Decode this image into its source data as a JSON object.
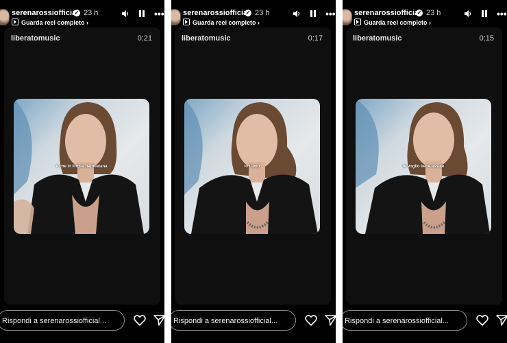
{
  "stories": [
    {
      "header": {
        "username": "serenarossiofficial",
        "time": "23 h",
        "cta": "Guarda reel completo ›"
      },
      "card": {
        "account": "liberatomusic",
        "timer": "0:21",
        "caption": "è che in lingua napoletana"
      },
      "footer": {
        "reply_placeholder": "Rispondi a serenarossiofficial..."
      }
    },
    {
      "header": {
        "username": "serenarossiofficial",
        "time": "23 h",
        "cta": "Guarda reel completo ›"
      },
      "card": {
        "account": "liberatomusic",
        "timer": "0:17",
        "caption": "io t'amo"
      },
      "footer": {
        "reply_placeholder": "Rispondi a serenarossiofficial..."
      }
    },
    {
      "header": {
        "username": "serenarossiofficial",
        "time": "23 h",
        "cta": "Guarda reel completo ›"
      },
      "card": {
        "account": "liberatomusic",
        "timer": "0:15",
        "caption": "te voglio bene assaje"
      },
      "footer": {
        "reply_placeholder": "Rispondi a serenarossiofficial..."
      }
    }
  ],
  "icons": {
    "verified": "verified-badge-icon",
    "sound": "speaker-icon",
    "pause": "pause-icon",
    "more": "more-dots-icon",
    "like": "heart-icon",
    "share": "send-icon"
  },
  "colors": {
    "background": "#000000",
    "text": "#ffffff",
    "reply_border": "#8c8c8c"
  }
}
